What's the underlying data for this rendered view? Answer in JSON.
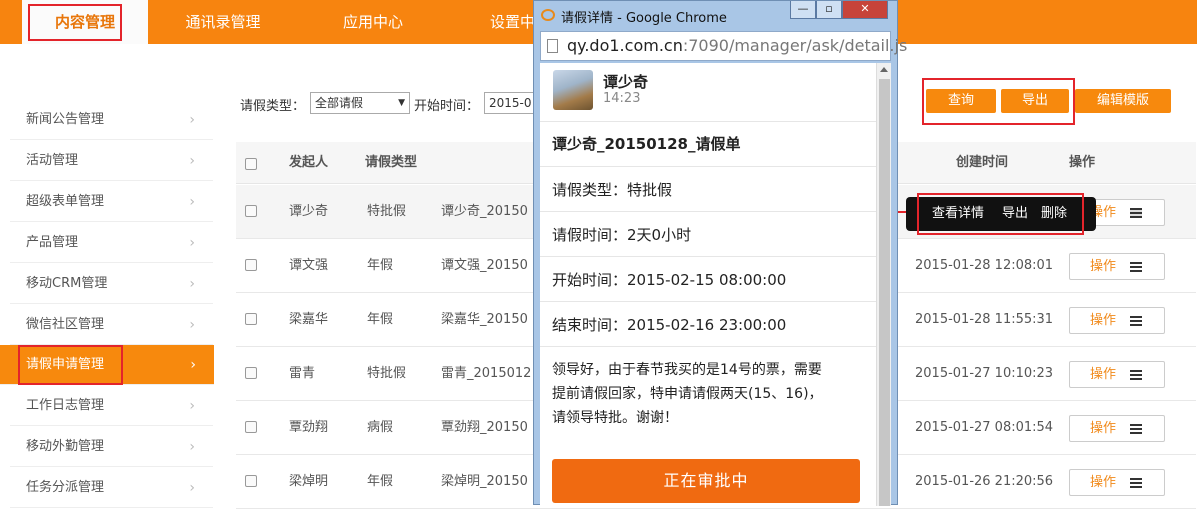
{
  "nav": {
    "items": [
      "内容管理",
      "通讯录管理",
      "应用中心",
      "设置中"
    ]
  },
  "sidebar": {
    "items": [
      "新闻公告管理",
      "活动管理",
      "超级表单管理",
      "产品管理",
      "移动CRM管理",
      "微信社区管理",
      "请假申请管理",
      "工作日志管理",
      "移动外勤管理",
      "任务分派管理"
    ],
    "active_index": 6
  },
  "filter": {
    "type_label": "请假类型：",
    "type_value": "全部请假",
    "start_label": "开始时间：",
    "start_value": "2015-0"
  },
  "actions": {
    "query": "查询",
    "export": "导出",
    "edit_template": "编辑模版"
  },
  "table": {
    "headers": [
      "发起人",
      "请假类型",
      "创建时间",
      "操作"
    ],
    "rows": [
      {
        "initiator": "谭少奇",
        "type": "特批假",
        "title": "谭少奇_20150",
        "time": "",
        "op": "操作"
      },
      {
        "initiator": "谭文强",
        "type": "年假",
        "title": "谭文强_20150",
        "time": "2015-01-28 12:08:01",
        "op": "操作"
      },
      {
        "initiator": "梁嘉华",
        "type": "年假",
        "title": "梁嘉华_20150",
        "time": "2015-01-28 11:55:31",
        "op": "操作"
      },
      {
        "initiator": "雷青",
        "type": "特批假",
        "title": "雷青_2015012",
        "time": "2015-01-27 10:10:23",
        "op": "操作"
      },
      {
        "initiator": "覃劲翔",
        "type": "病假",
        "title": "覃劲翔_20150",
        "time": "2015-01-27 08:01:54",
        "op": "操作"
      },
      {
        "initiator": "梁焯明",
        "type": "年假",
        "title": "梁焯明_20150",
        "time": "2015-01-26 21:20:56",
        "op": "操作"
      }
    ]
  },
  "tooltip": {
    "view": "查看详情",
    "export": "导出",
    "delete": "删除"
  },
  "popup": {
    "window_title": "请假详情 - Google Chrome",
    "url_host": "qy.do1.com.cn",
    "url_path": ":7090/manager/ask/detail.js",
    "user_name": "谭少奇",
    "user_time": "14:23",
    "form_title": "谭少奇_20150128_请假单",
    "leave_type": "请假类型：特批假",
    "leave_duration": "请假时间：2天0小时",
    "start_time": "开始时间：2015-02-15 08:00:00",
    "end_time": "结束时间：2015-02-16 23:00:00",
    "reason_lines": [
      "领导好，由于春节我买的是14号的票，需要",
      "提前请假回家，特申请请假两天(15、16)，",
      "请领导特批。谢谢！"
    ],
    "status_button": "正在审批中"
  },
  "colors": {
    "brand_orange": "#f7890d",
    "highlight_red": "#e3242b",
    "status_orange": "#f06a11"
  }
}
